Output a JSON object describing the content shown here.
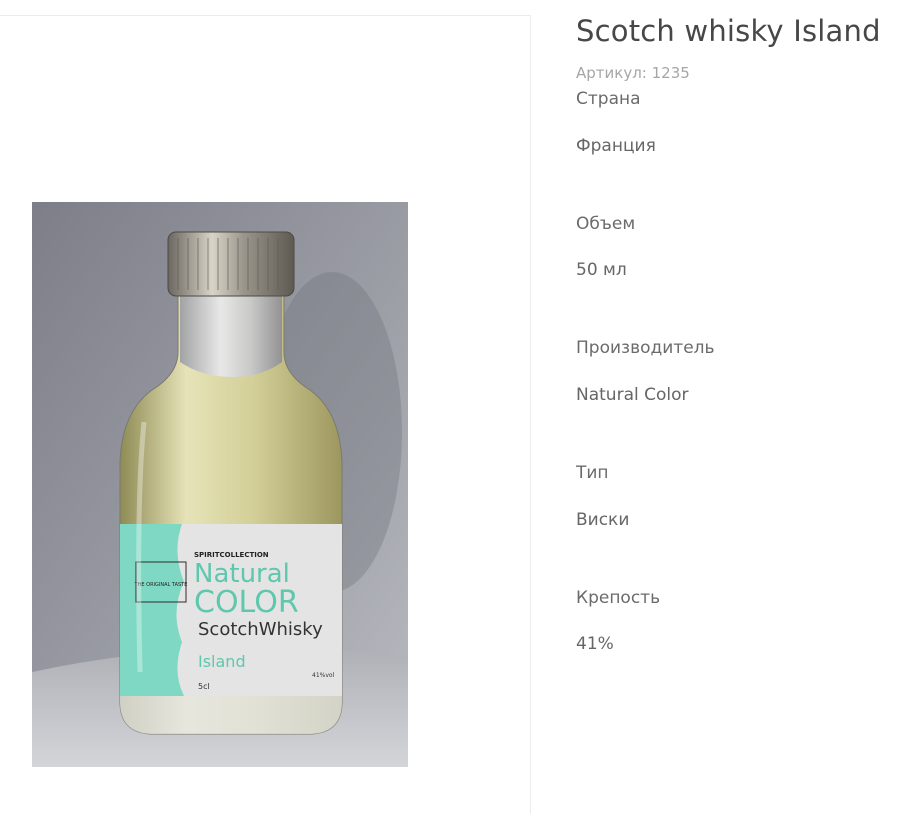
{
  "product": {
    "title": "Scotch whisky Island",
    "sku_label": "Артикул: 1235"
  },
  "attributes": [
    {
      "name": "Страна",
      "value": "Франция"
    },
    {
      "name": "Объем",
      "value": "50 мл"
    },
    {
      "name": "Производитель",
      "value": "Natural Color"
    },
    {
      "name": "Тип",
      "value": "Виски"
    },
    {
      "name": "Крепость",
      "value": "41%"
    }
  ],
  "label": {
    "brand_top": "SPIRITCOLLECTION",
    "brand_line1": "Natural",
    "brand_line2": "COLOR",
    "product_line": "ScotchWhisky",
    "variant": "Island",
    "volume": "5cl",
    "abv": "41%vol",
    "badge_line": "THE ORIGINAL TASTE",
    "accent_color": "#7fd8c3"
  },
  "colors": {
    "title": "#474747",
    "text": "#6b6b6b",
    "muted": "#a6a6a6",
    "divider": "#ececec"
  }
}
